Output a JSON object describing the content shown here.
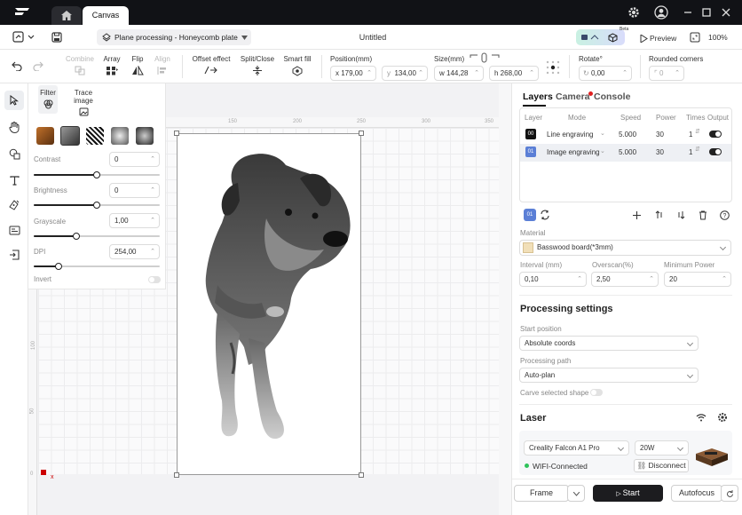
{
  "titlebar": {
    "tab_label": "Canvas"
  },
  "toolbar1": {
    "mode_label": "Plane processing - Honeycomb plate",
    "doc_title": "Untitled",
    "badge": "Beta",
    "preview_label": "Preview",
    "zoom": "100%"
  },
  "toolbar2": {
    "combine": "Combine",
    "array": "Array",
    "flip": "Flip",
    "align": "Align",
    "offset": "Offset effect",
    "split": "Split/Close",
    "smart_fill": "Smart fill",
    "position_label": "Position(mm)",
    "x": "x  179,00",
    "y": "134,00",
    "size_label": "Size(mm)",
    "w": "w  144,28",
    "h": "h  268,00",
    "rotate_label": "Rotate°",
    "rotate": "0,00",
    "corners_label": "Rounded corners",
    "corners": "0"
  },
  "image_panel": {
    "filter_tab": "Filter",
    "trace_tab": "Trace image",
    "contrast_label": "Contrast",
    "contrast": "0",
    "contrast_pct": 0.5,
    "brightness_label": "Brightness",
    "brightness": "0",
    "brightness_pct": 0.5,
    "grayscale_label": "Grayscale",
    "grayscale": "1,00",
    "grayscale_pct": 0.34,
    "dpi_label": "DPI",
    "dpi": "254,00",
    "dpi_pct": 0.2,
    "invert_label": "Invert"
  },
  "ruler": {
    "top": [
      "150",
      "200",
      "250",
      "300",
      "350"
    ],
    "left": [
      "100",
      "50",
      "0"
    ]
  },
  "right": {
    "tab_layers": "Layers",
    "tab_camera": "Camera",
    "tab_console": "Console",
    "headers": [
      "Layer",
      "Mode",
      "Speed",
      "Power",
      "Times",
      "Output"
    ],
    "layers": [
      {
        "id": "00",
        "mode": "Line engraving",
        "speed": "5.000",
        "power": "30",
        "times": "1",
        "color": "#111111"
      },
      {
        "id": "01",
        "mode": "Image engraving",
        "speed": "5.000",
        "power": "30",
        "times": "1",
        "color": "#5b7fd6"
      }
    ],
    "selected_layer": "01",
    "material_label": "Material",
    "material": "Basswood board(*3mm)",
    "interval_label": "Interval (mm)",
    "interval": "0,10",
    "overscan_label": "Overscan(%)",
    "overscan": "2,50",
    "minpower_label": "Minimum Power",
    "minpower": "20",
    "processing_title": "Processing settings",
    "start_label": "Start position",
    "start": "Absolute coords",
    "path_label": "Processing path",
    "path": "Auto-plan",
    "carve_label": "Carve selected shape",
    "laser_title": "Laser",
    "device": "Creality Falcon A1 Pro",
    "power": "20W",
    "wifi": "WIFI-Connected",
    "disconnect": "Disconnect",
    "frame": "Frame",
    "start_btn": "Start",
    "autofocus": "Autofocus"
  }
}
